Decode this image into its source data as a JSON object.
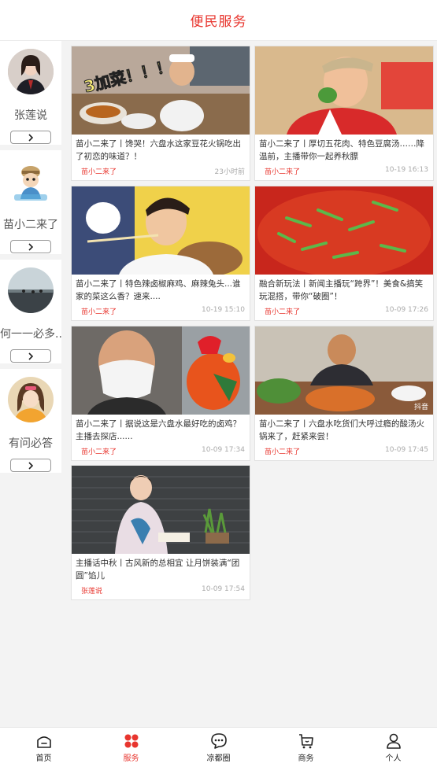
{
  "header": {
    "title": "便民服务"
  },
  "authors": [
    {
      "name": "张莲说"
    },
    {
      "name": "苗小二来了"
    },
    {
      "name": "何一一必多..."
    },
    {
      "name": "有问必答"
    }
  ],
  "cards": [
    {
      "title": "苗小二来了丨馋哭！六盘水这家豆花火锅吃出了初恋的味道？！",
      "author": "苗小二来了",
      "time": "23小时前",
      "overlay": "3加菜！！！"
    },
    {
      "title": "苗小二来了丨厚切五花肉、特色豆腐汤……降温前，主播带你一起养秋膘",
      "author": "苗小二来了",
      "time": "10-19 16:13"
    },
    {
      "title": "苗小二来了丨特色辣卤椒麻鸡、麻辣兔头...谁家的菜这么香？速来....",
      "author": "苗小二来了",
      "time": "10-19 15:10"
    },
    {
      "title": "融合新玩法丨新闻主播玩“跨界”！美食&搞笑玩混搭，带你“破圈”！",
      "author": "苗小二来了",
      "time": "10-09 17:26"
    },
    {
      "title": "苗小二来了丨据说这是六盘水最好吃的卤鸡？主播去探店......",
      "author": "苗小二来了",
      "time": "10-09 17:34"
    },
    {
      "title": "苗小二来了丨六盘水吃货们大呼过瘾的酸汤火锅来了，赶紧来尝！",
      "author": "苗小二来了",
      "time": "10-09 17:45",
      "watermark": "抖音"
    },
    {
      "title": "主播话中秋丨古风新的总相宜 让月饼装满“团圆”馅儿",
      "author": "张莲说",
      "time": "10-09 17:54"
    }
  ],
  "tabs": [
    {
      "label": "首页"
    },
    {
      "label": "服务"
    },
    {
      "label": "凉都圈"
    },
    {
      "label": "商务"
    },
    {
      "label": "个人"
    }
  ],
  "colors": {
    "accent": "#e8352e",
    "background": "#f3f3f3"
  }
}
